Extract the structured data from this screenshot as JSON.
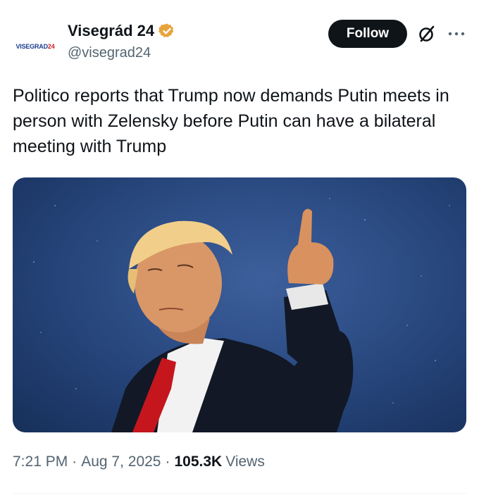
{
  "author": {
    "avatar_text": "VISEGRAD",
    "avatar_accent": "24",
    "display_name": "Visegrád 24",
    "handle": "@visegrad24",
    "verified_icon": "verified-badge-icon",
    "verified_color": "#e8a33d"
  },
  "header": {
    "follow_label": "Follow",
    "grok_icon": "grok-icon",
    "more_icon": "more-icon"
  },
  "tweet": {
    "text": "Politico reports that Trump now demands Putin meets in person with Zelensky before Putin can have a bilateral meeting with Trump"
  },
  "media": {
    "type": "photo"
  },
  "meta": {
    "time": "7:21 PM",
    "separator": "·",
    "date": "Aug 7, 2025",
    "views_count": "105.3K",
    "views_label": "Views"
  },
  "colors": {
    "text_primary": "#0f1419",
    "text_secondary": "#536471",
    "follow_bg": "#0f1419",
    "media_bg": "#2e4f88"
  }
}
